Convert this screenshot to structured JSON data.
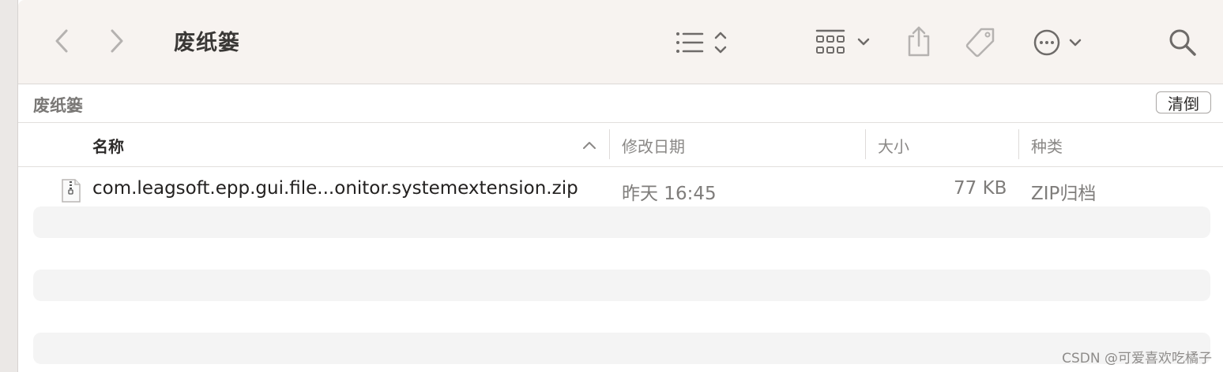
{
  "toolbar": {
    "title": "废纸篓",
    "back_icon": "chevron-left-icon",
    "forward_icon": "chevron-right-icon",
    "view_list_icon": "list-view-icon",
    "group_icon": "grid-group-icon",
    "share_icon": "share-icon",
    "tag_icon": "tag-icon",
    "more_icon": "ellipsis-circle-icon",
    "search_icon": "search-icon"
  },
  "pathbar": {
    "title": "废纸篓",
    "empty_label": "清倒"
  },
  "columns": {
    "name": "名称",
    "modified": "修改日期",
    "size": "大小",
    "kind": "种类"
  },
  "files": [
    {
      "name": "com.leagsoft.epp.gui.file...onitor.systemextension.zip",
      "modified": "昨天 16:45",
      "size": "77 KB",
      "kind": "ZIP归档"
    }
  ],
  "watermark": "CSDN @可爱喜欢吃橘子",
  "colors": {
    "toolbar_bg": "#f7f3f0",
    "accent_orange": "#f0a030"
  }
}
